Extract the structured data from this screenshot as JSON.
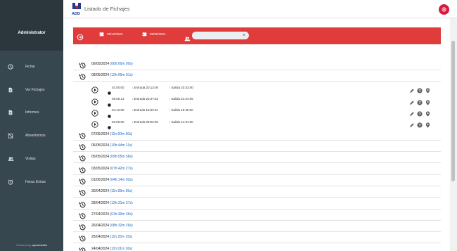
{
  "app": {
    "title": "Listado de Fichajes",
    "logo_text": "ADD"
  },
  "sidebar": {
    "user": "Administrator",
    "items": [
      {
        "label": "Fichar",
        "icon": "clock-icon"
      },
      {
        "label": "Ver Fichajes",
        "icon": "document-icon"
      },
      {
        "label": "Informes",
        "icon": "report-icon"
      },
      {
        "label": "Absentismos",
        "icon": "absence-icon"
      },
      {
        "label": "Visitas",
        "icon": "people-icon"
      },
      {
        "label": "Horas Extras",
        "icon": "alarm-icon"
      }
    ],
    "footer_prefix": "Powered by",
    "footer_brand": "openmedia"
  },
  "filters": {
    "date_from": "09/12/2023",
    "date_to": "09/05/2024"
  },
  "days_top": [
    {
      "date": "09/05/2024",
      "dur": "(00h:00m 00s)"
    },
    {
      "date": "08/05/2024",
      "dur": "(12h:00m 01s)"
    }
  ],
  "entries": [
    {
      "time": "01:00:00",
      "in_label": "Entrada",
      "in_time": "20:13:00",
      "out_label": "Salida",
      "out_time": "23:43:00"
    },
    {
      "time": "06:56:13",
      "in_label": "Entrada",
      "in_time": "20:27:52",
      "out_label": "Salida",
      "out_time": "21:24:05"
    },
    {
      "time": "04:12:09",
      "in_label": "Entrada",
      "in_time": "15:02:31",
      "out_label": "Salida",
      "out_time": "19:45:00"
    },
    {
      "time": "02:00:00",
      "in_label": "Entrada",
      "in_time": "09:02:00",
      "out_label": "Salida",
      "out_time": "14:31:00"
    }
  ],
  "days_bottom": [
    {
      "date": "07/05/2024",
      "dur": "(11h:00m 50s)"
    },
    {
      "date": "06/05/2024",
      "dur": "(10h:44m 11s)"
    },
    {
      "date": "05/05/2024",
      "dur": "(09h:55m 58s)"
    },
    {
      "date": "03/05/2024",
      "dur": "(07h:42m 27s)"
    },
    {
      "date": "01/05/2024",
      "dur": "(04h:14m 03s)"
    },
    {
      "date": "30/04/2024",
      "dur": "(11h:08m 55s)"
    },
    {
      "date": "29/04/2024",
      "dur": "(12h:31m 37s)"
    },
    {
      "date": "27/04/2024",
      "dur": "(01h:30m 35s)"
    },
    {
      "date": "26/04/2024",
      "dur": "(08h:32m 26s)"
    },
    {
      "date": "25/04/2024",
      "dur": "(11h:25m 25s)"
    },
    {
      "date": "24/04/2024",
      "dur": "(11h:01m 26s)"
    }
  ],
  "colors": {
    "accent": "#e03c3c",
    "sidebar": "#37474f",
    "duration": "#1565c0"
  }
}
